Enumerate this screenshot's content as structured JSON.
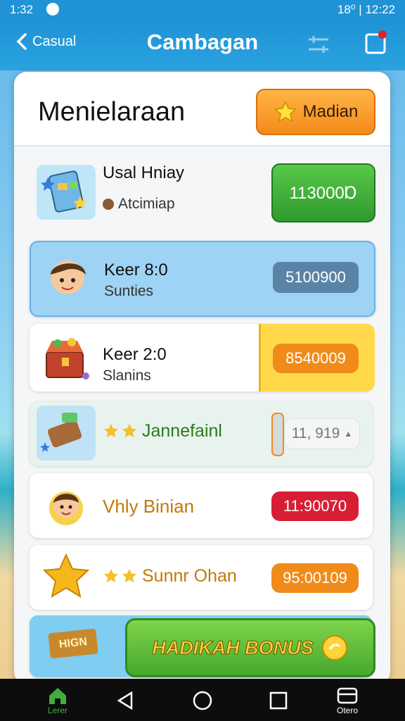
{
  "status": {
    "time": "1:32",
    "right_text": "18⁰ | 12:22"
  },
  "app_bar": {
    "back_label": "Casual",
    "title": "Cambagan"
  },
  "panel": {
    "title": "Menielaraan",
    "header_button": "Madian",
    "rows": [
      {
        "title": "Usal Hniay",
        "subtitle": "Atcimiap",
        "value": "113000Ɒ"
      },
      {
        "title": "Keer 8:0",
        "subtitle": "Sunties",
        "value": "5100900"
      },
      {
        "title": "Keer 2:0",
        "subtitle": "Slanins",
        "value": "8540009"
      },
      {
        "title": "Jannefainl",
        "value": "11, 919"
      },
      {
        "title": "Vhly Binian",
        "value": "11:90070"
      },
      {
        "title": "Sunnr Ohan",
        "value": "95:00109"
      }
    ],
    "bonus_button": "HADIKAH BONUS",
    "bonus_tag": "HIGN"
  },
  "bottom_nav": {
    "home_label": "Lerer",
    "other_label": "Otero"
  },
  "colors": {
    "app_bar": "#1f93d6",
    "green": "#3fae3a",
    "orange": "#f08b1a",
    "red": "#d81e35",
    "blue_slate": "#5a84a6",
    "yellow": "#ffd94a"
  }
}
